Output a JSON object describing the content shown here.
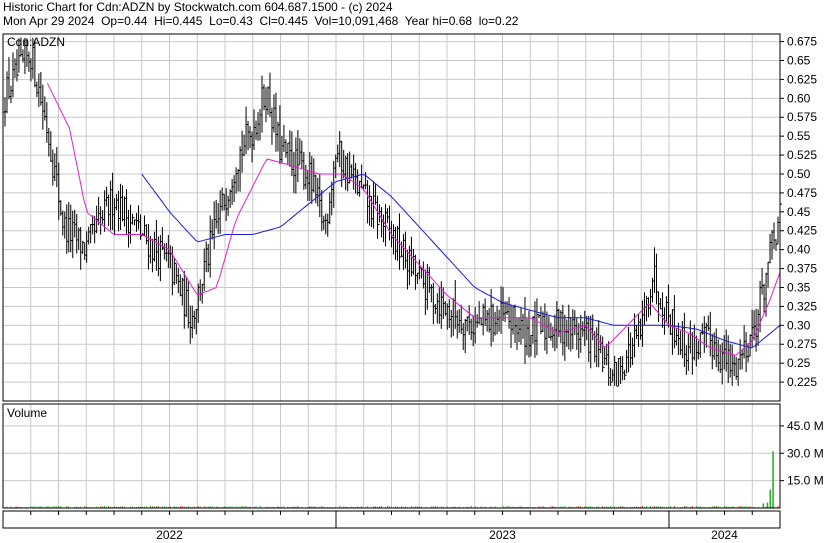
{
  "header": {
    "line1": "Historic Chart for Cdn:ADZN by Stockwatch.com 604.687.1500 - (c) 2024",
    "line2": "Mon Apr 29 2024  Op=0.44  Hi=0.445  Lo=0.43  Cl=0.445  Vol=10,091,468  Year hi=0.68  lo=0.22"
  },
  "colors": {
    "price_bars": "#000000",
    "ma_short": "#e020d0",
    "ma_long": "#1a1ad8",
    "volume_bars": "#22aa22",
    "volume_down": "#cc2222",
    "grid": "#c8c8c8",
    "frame": "#000000"
  },
  "chart_data": [
    {
      "type": "ohlc",
      "title": "Cdn:ADZN",
      "ylim": [
        0.2,
        0.685
      ],
      "yticks": [
        "0.675",
        "0.65",
        "0.625",
        "0.60",
        "0.575",
        "0.55",
        "0.525",
        "0.50",
        "0.475",
        "0.45",
        "0.425",
        "0.40",
        "0.375",
        "0.35",
        "0.325",
        "0.30",
        "0.275",
        "0.25",
        "0.225"
      ],
      "x_range": [
        0,
        28
      ],
      "x_unit": "months from Jan 2022",
      "x_labels": [
        "2022",
        "2023",
        "2024"
      ],
      "close_anchors": [
        [
          0,
          0.6
        ],
        [
          1,
          0.66
        ],
        [
          1.6,
          0.56
        ],
        [
          2.2,
          0.43
        ],
        [
          3,
          0.4
        ],
        [
          4,
          0.47
        ],
        [
          5,
          0.42
        ],
        [
          6,
          0.38
        ],
        [
          6.8,
          0.31
        ],
        [
          7.6,
          0.42
        ],
        [
          8.4,
          0.52
        ],
        [
          9,
          0.56
        ],
        [
          9.5,
          0.61
        ],
        [
          10,
          0.53
        ],
        [
          11,
          0.5
        ],
        [
          11.6,
          0.43
        ],
        [
          12,
          0.53
        ],
        [
          13,
          0.47
        ],
        [
          14,
          0.42
        ],
        [
          15,
          0.36
        ],
        [
          16,
          0.32
        ],
        [
          17,
          0.3
        ],
        [
          18,
          0.31
        ],
        [
          19,
          0.29
        ],
        [
          20,
          0.3
        ],
        [
          21,
          0.29
        ],
        [
          22,
          0.23
        ],
        [
          23,
          0.29
        ],
        [
          23.4,
          0.37
        ],
        [
          23.9,
          0.32
        ],
        [
          24.6,
          0.27
        ],
        [
          25.5,
          0.28
        ],
        [
          26.3,
          0.24
        ],
        [
          27.1,
          0.3
        ],
        [
          27.7,
          0.4
        ],
        [
          28,
          0.44
        ]
      ],
      "ma_short_anchors": [
        [
          1.6,
          0.62
        ],
        [
          2.4,
          0.56
        ],
        [
          3,
          0.45
        ],
        [
          4,
          0.42
        ],
        [
          5,
          0.42
        ],
        [
          6,
          0.4
        ],
        [
          7,
          0.34
        ],
        [
          7.7,
          0.35
        ],
        [
          8.4,
          0.44
        ],
        [
          9.5,
          0.52
        ],
        [
          10.5,
          0.51
        ],
        [
          11.4,
          0.5
        ],
        [
          12.2,
          0.5
        ],
        [
          13,
          0.48
        ],
        [
          14,
          0.42
        ],
        [
          15,
          0.38
        ],
        [
          16,
          0.34
        ],
        [
          17,
          0.31
        ],
        [
          18,
          0.31
        ],
        [
          19,
          0.31
        ],
        [
          20,
          0.29
        ],
        [
          21,
          0.3
        ],
        [
          21.7,
          0.27
        ],
        [
          22.5,
          0.3
        ],
        [
          23.3,
          0.33
        ],
        [
          24,
          0.3
        ],
        [
          24.7,
          0.29
        ],
        [
          25.5,
          0.27
        ],
        [
          26.4,
          0.26
        ],
        [
          27,
          0.28
        ],
        [
          27.6,
          0.33
        ],
        [
          28,
          0.37
        ]
      ],
      "ma_long_anchors": [
        [
          5,
          0.5
        ],
        [
          6,
          0.45
        ],
        [
          7,
          0.41
        ],
        [
          8,
          0.42
        ],
        [
          9,
          0.42
        ],
        [
          10,
          0.43
        ],
        [
          11,
          0.46
        ],
        [
          12,
          0.49
        ],
        [
          13,
          0.5
        ],
        [
          14,
          0.47
        ],
        [
          15,
          0.43
        ],
        [
          16,
          0.39
        ],
        [
          17,
          0.35
        ],
        [
          18,
          0.33
        ],
        [
          19,
          0.32
        ],
        [
          20,
          0.31
        ],
        [
          21,
          0.31
        ],
        [
          22,
          0.3
        ],
        [
          23,
          0.3
        ],
        [
          24,
          0.3
        ],
        [
          25,
          0.295
        ],
        [
          26,
          0.28
        ],
        [
          27,
          0.27
        ],
        [
          28,
          0.3
        ]
      ]
    },
    {
      "type": "bar",
      "title": "Volume",
      "yticks": [
        "45.0 M",
        "30.0 M",
        "15.0 M"
      ],
      "ylim": [
        0,
        57
      ],
      "spikes": [
        [
          27.75,
          31
        ],
        [
          27.65,
          10
        ],
        [
          27.55,
          3
        ],
        [
          27.4,
          2.5
        ]
      ]
    }
  ]
}
